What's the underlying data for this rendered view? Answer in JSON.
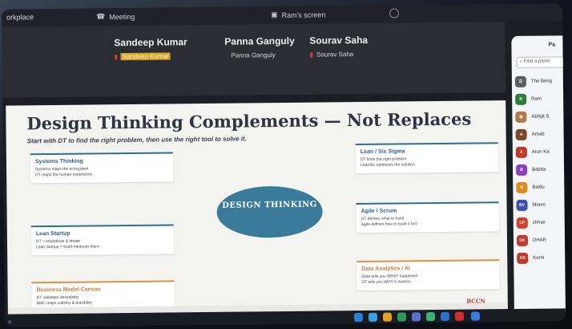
{
  "titlebar": {
    "app": "orkplace",
    "meeting": "Meeting",
    "share": "Ram's screen"
  },
  "participants": [
    {
      "big": "Sandeep Kumar",
      "small": "Sandeep Kumar"
    },
    {
      "big": "Panna Ganguly",
      "small": "Panna Ganguly"
    },
    {
      "big": "Sourav Saha",
      "small": "Sourav Saha"
    }
  ],
  "slide": {
    "title": "Design Thinking Complements — Not Replaces",
    "subtitle": "Start with DT to find the right problem, then use the right tool to solve it.",
    "center": "DESIGN THINKING",
    "cards": [
      {
        "title": "Systems Thinking",
        "line1": "Systems maps the ecosystem",
        "line2": "DT maps the human experience"
      },
      {
        "title": "Lean Startup",
        "line1": "DT = empathize & ideate",
        "line2": "Lean Startup = build-measure-learn"
      },
      {
        "title": "Business Model Canvas",
        "line1": "DT validates desirability",
        "line2": "BMC maps viability & feasibility"
      },
      {
        "title": "Lean / Six Sigma",
        "line1": "DT finds the right problem",
        "line2": "Lean/6σ optimizes the solution"
      },
      {
        "title": "Agile / Scrum",
        "line1": "DT defines what to build",
        "line2": "Agile defines how to build it fast"
      },
      {
        "title": "Data Analytics / AI",
        "line1": "Data tells you WHAT happened",
        "line2": "DT tells you WHY it matters"
      }
    ],
    "logo": "BCCN"
  },
  "sidebar": {
    "title": "Pa",
    "search_placeholder": "Find a partic",
    "items": [
      {
        "initials": "",
        "name": "The Beng",
        "color": "#5a5d66"
      },
      {
        "initials": "R",
        "name": "Ram",
        "color": "#2e7d3a"
      },
      {
        "initials": "",
        "name": "Abhijit S",
        "color": "#b07a4a"
      },
      {
        "initials": "A",
        "name": "Arnab",
        "color": "#7a4a2a"
      },
      {
        "initials": "A",
        "name": "Arun Ka",
        "color": "#c0392b"
      },
      {
        "initials": "B",
        "name": "Babita",
        "color": "#8a3fc0"
      },
      {
        "initials": "B",
        "name": "Baidu",
        "color": "#e08a22"
      },
      {
        "initials": "BV",
        "name": "bhave",
        "color": "#3a4fb0"
      },
      {
        "initials": "CP",
        "name": "chhav",
        "color": "#d0402a"
      },
      {
        "initials": "DK",
        "name": "DHAR",
        "color": "#c0392b"
      },
      {
        "initials": "KR",
        "name": "Karni",
        "color": "#c0392b"
      }
    ]
  }
}
